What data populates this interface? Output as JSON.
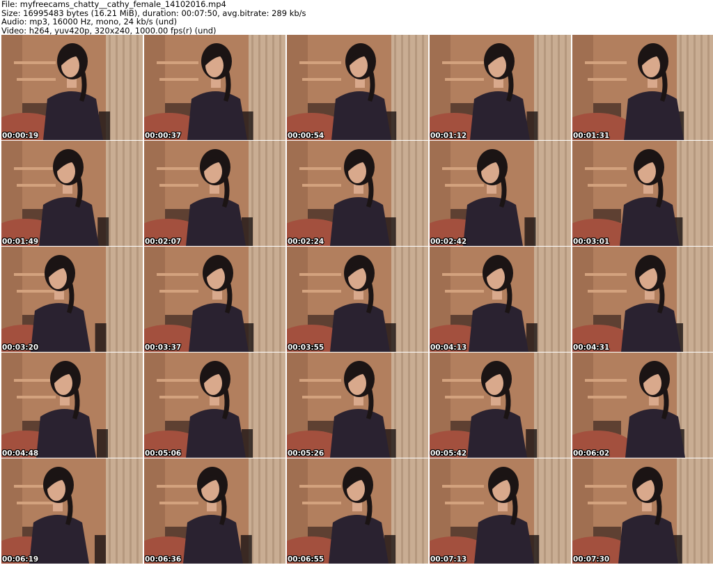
{
  "header": {
    "file_line": "File: myfreecams_chatty__cathy_female_14102016.mp4",
    "size_line": "Size: 16995483 bytes (16.21 MiB), duration: 00:07:50, avg.bitrate: 289 kb/s",
    "audio_line": "Audio: mp3, 16000 Hz, mono, 24 kb/s (und)",
    "video_line": "Video: h264, yuv420p, 320x240, 1000.00 fps(r) (und)"
  },
  "thumbnails": [
    {
      "timestamp": "00:00:19"
    },
    {
      "timestamp": "00:00:37"
    },
    {
      "timestamp": "00:00:54"
    },
    {
      "timestamp": "00:01:12"
    },
    {
      "timestamp": "00:01:31"
    },
    {
      "timestamp": "00:01:49"
    },
    {
      "timestamp": "00:02:07"
    },
    {
      "timestamp": "00:02:24"
    },
    {
      "timestamp": "00:02:42"
    },
    {
      "timestamp": "00:03:01"
    },
    {
      "timestamp": "00:03:20"
    },
    {
      "timestamp": "00:03:37"
    },
    {
      "timestamp": "00:03:55"
    },
    {
      "timestamp": "00:04:13"
    },
    {
      "timestamp": "00:04:31"
    },
    {
      "timestamp": "00:04:48"
    },
    {
      "timestamp": "00:05:06"
    },
    {
      "timestamp": "00:05:26"
    },
    {
      "timestamp": "00:05:42"
    },
    {
      "timestamp": "00:06:02"
    },
    {
      "timestamp": "00:06:19"
    },
    {
      "timestamp": "00:06:36"
    },
    {
      "timestamp": "00:06:55"
    },
    {
      "timestamp": "00:07:13"
    },
    {
      "timestamp": "00:07:30"
    }
  ],
  "colors": {
    "wall": "#b27f5e",
    "wall_shadow": "#8e5f44",
    "curtain": "#c9ad93",
    "curtain_dark": "#a88a70",
    "bed": "#a3503e",
    "shelf": "#d3a27e",
    "shirt": "#2a2230",
    "hair": "#1b1414",
    "skin": "#d9a98c",
    "label_text": "#ffffff"
  }
}
